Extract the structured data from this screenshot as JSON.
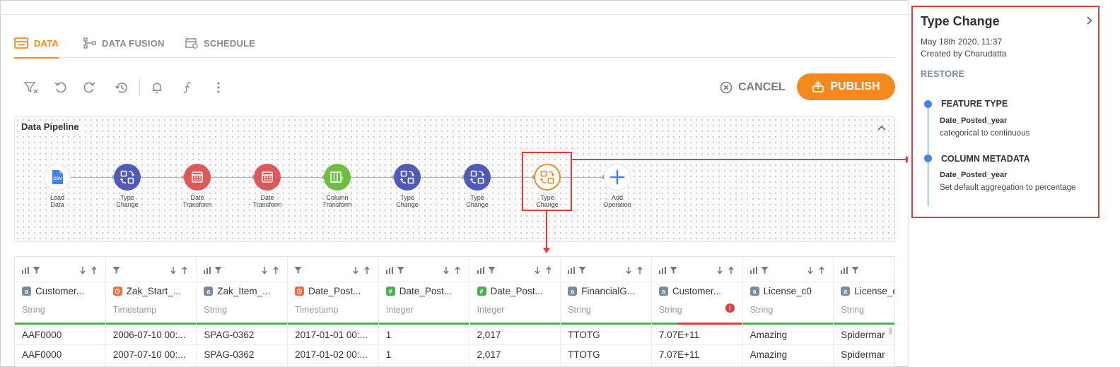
{
  "tabs": [
    {
      "label": "DATA",
      "icon": "table-icon",
      "active": true
    },
    {
      "label": "DATA FUSION",
      "icon": "fusion-icon",
      "active": false
    },
    {
      "label": "SCHEDULE",
      "icon": "calendar-icon",
      "active": false
    }
  ],
  "toolbar": {
    "icons": [
      "clear-filter-icon",
      "undo-icon",
      "redo-icon",
      "history-icon",
      "bell-icon",
      "function-icon",
      "more-vertical-icon"
    ],
    "cancel_label": "CANCEL",
    "publish_label": "PUBLISH"
  },
  "pipeline": {
    "title": "Data Pipeline",
    "nodes": [
      {
        "label": "Load\nData",
        "kind": "load",
        "color": "#ffffff",
        "icon": "csv-file-icon"
      },
      {
        "label": "Type\nChange",
        "kind": "type",
        "color": "#4f5bb8",
        "icon": "type-change-icon"
      },
      {
        "label": "Date\nTransform",
        "kind": "date",
        "color": "#e05757",
        "icon": "calendar-icon"
      },
      {
        "label": "Date\nTransform",
        "kind": "date",
        "color": "#e05757",
        "icon": "calendar-icon"
      },
      {
        "label": "Column\nTransform",
        "kind": "column",
        "color": "#6cbf3f",
        "icon": "column-transform-icon"
      },
      {
        "label": "Type\nChange",
        "kind": "type",
        "color": "#4f5bb8",
        "icon": "type-change-icon"
      },
      {
        "label": "Type\nChange",
        "kind": "type",
        "color": "#4f5bb8",
        "icon": "type-change-icon"
      },
      {
        "label": "Type\nChange",
        "kind": "selected",
        "color": "#f5891c",
        "icon": "type-change-icon"
      },
      {
        "label": "Add\nOperation",
        "kind": "add",
        "color": "#3d86ea",
        "icon": "plus-icon"
      }
    ]
  },
  "table": {
    "columns": [
      {
        "name": "Customer...",
        "badge": "a",
        "badge_color": "#7b8b9b",
        "type": "String"
      },
      {
        "name": "Zak_Start_...",
        "badge": "◷",
        "badge_color": "#f06a3c",
        "type": "Timestamp"
      },
      {
        "name": "Zak_Item_...",
        "badge": "a",
        "badge_color": "#7b8b9b",
        "type": "String"
      },
      {
        "name": "Date_Post...",
        "badge": "◷",
        "badge_color": "#f06a3c",
        "type": "Timestamp"
      },
      {
        "name": "Date_Post...",
        "badge": "#",
        "badge_color": "#4caf50",
        "type": "Integer"
      },
      {
        "name": "Date_Post...",
        "badge": "#",
        "badge_color": "#4caf50",
        "type": "Integer"
      },
      {
        "name": "FinancialG...",
        "badge": "a",
        "badge_color": "#7b8b9b",
        "type": "String"
      },
      {
        "name": "Customer...",
        "badge": "a",
        "badge_color": "#7b8b9b",
        "type": "String",
        "error": true
      },
      {
        "name": "License_c0",
        "badge": "a",
        "badge_color": "#7b8b9b",
        "type": "String"
      },
      {
        "name": "License_c",
        "badge": "a",
        "badge_color": "#7b8b9b",
        "type": "String"
      }
    ],
    "rows": [
      [
        "AAF0000",
        "2006-07-10 00:...",
        "SPAG-0362",
        "2017-01-01 00:...",
        "1",
        "2,017",
        "TTOTG",
        "7.07E+11",
        "Amazing",
        "Spidermar"
      ],
      [
        "AAF0000",
        "2007-07-10 00:...",
        "SPAG-0362",
        "2017-01-02 00:...",
        "1",
        "2,017",
        "TTOTG",
        "7.07E+11",
        "Amazing",
        "Spidermar"
      ]
    ],
    "quality_colors": {
      "ok": "#4caf50",
      "error": "#e53b3b"
    }
  },
  "panel": {
    "title": "Type Change",
    "date": "May 18th 2020, 11:37",
    "author": "Created by Charudatta",
    "restore_label": "RESTORE",
    "events": [
      {
        "heading": "FEATURE TYPE",
        "column": "Date_Posted_year",
        "description": "categorical to continuous"
      },
      {
        "heading": "COLUMN METADATA",
        "column": "Date_Posted_year",
        "description": "Set default aggregation to percentage"
      }
    ]
  },
  "colors": {
    "accent": "#f5891c",
    "annotation": "#e53b3b",
    "timeline": "#3d86ea"
  }
}
